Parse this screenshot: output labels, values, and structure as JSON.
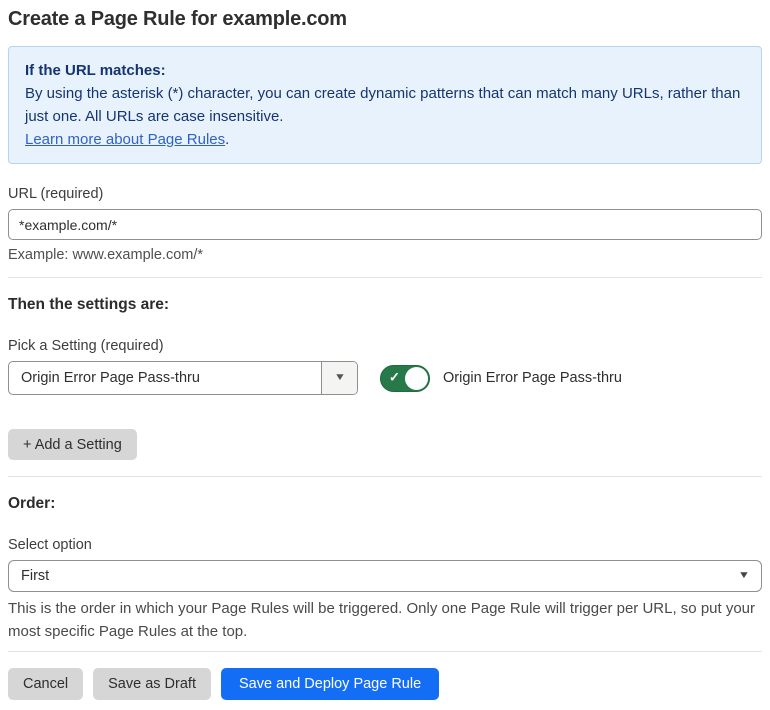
{
  "page": {
    "title": "Create a Page Rule for example.com"
  },
  "info_box": {
    "heading": "If the URL matches:",
    "body": "By using the asterisk (*) character, you can create dynamic patterns that can match many URLs, rather than just one. All URLs are case insensitive.",
    "link_label": "Learn more about Page Rules",
    "link_suffix": "."
  },
  "url_section": {
    "label": "URL (required)",
    "value": "*example.com/*",
    "example": "Example: www.example.com/*"
  },
  "settings_section": {
    "heading": "Then the settings are:",
    "picker_label": "Pick a Setting (required)",
    "picker_value": "Origin Error Page Pass-thru",
    "toggle_state": "on",
    "toggle_label": "Origin Error Page Pass-thru",
    "add_setting_label": "+ Add a Setting"
  },
  "order_section": {
    "heading": "Order:",
    "select_label": "Select option",
    "select_value": "First",
    "help_text": "This is the order in which your Page Rules will be triggered. Only one Page Rule will trigger per URL, so put your most specific Page Rules at the top."
  },
  "footer": {
    "cancel_label": "Cancel",
    "save_draft_label": "Save as Draft",
    "save_deploy_label": "Save and Deploy Page Rule"
  },
  "icons": {
    "dropdown_caret": "▼",
    "toggle_check": "✓"
  },
  "colors": {
    "info_box_bg": "#e8f2fc",
    "info_box_border": "#b9d3ee",
    "info_text": "#16356e",
    "link_blue": "#2f62c8",
    "toggle_green": "#27794a",
    "primary_button_blue": "#146ef5",
    "secondary_button_gray": "#d6d6d6"
  }
}
